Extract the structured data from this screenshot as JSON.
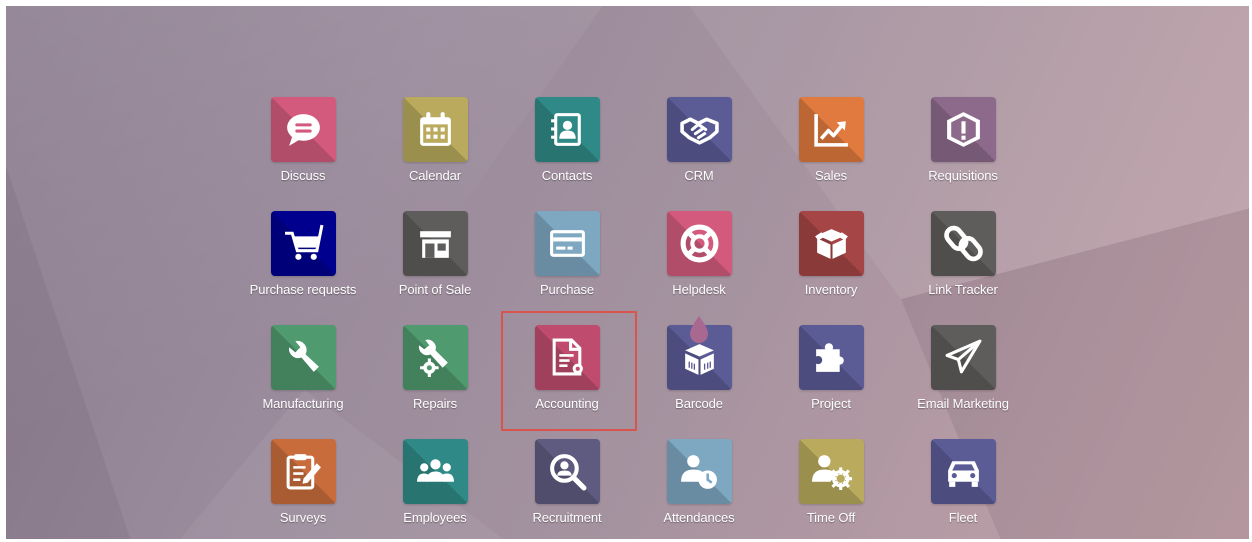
{
  "apps": [
    {
      "id": "discuss",
      "label": "Discuss",
      "icon": "chat-bubble-icon",
      "color": "#d35a7d"
    },
    {
      "id": "calendar",
      "label": "Calendar",
      "icon": "calendar-icon",
      "color": "#b9aa5d"
    },
    {
      "id": "contacts",
      "label": "Contacts",
      "icon": "address-book-icon",
      "color": "#2f8a87"
    },
    {
      "id": "crm",
      "label": "CRM",
      "icon": "handshake-icon",
      "color": "#5b5b96"
    },
    {
      "id": "sales",
      "label": "Sales",
      "icon": "trend-chart-icon",
      "color": "#e07a3e"
    },
    {
      "id": "requisitions",
      "label": "Requisitions",
      "icon": "alert-box-icon",
      "color": "#8d6a8b"
    },
    {
      "id": "purchase-requests",
      "label": "Purchase requests",
      "icon": "shopping-cart-icon",
      "color": "#00008f"
    },
    {
      "id": "point-of-sale",
      "label": "Point of Sale",
      "icon": "store-icon",
      "color": "#5f5d5b"
    },
    {
      "id": "purchase",
      "label": "Purchase",
      "icon": "credit-card-icon",
      "color": "#7ea7c2"
    },
    {
      "id": "helpdesk",
      "label": "Helpdesk",
      "icon": "life-ring-icon",
      "color": "#d35a7d"
    },
    {
      "id": "inventory",
      "label": "Inventory",
      "icon": "box-icon",
      "color": "#a64545"
    },
    {
      "id": "link-tracker",
      "label": "Link Tracker",
      "icon": "link-icon",
      "color": "#5f5d5b"
    },
    {
      "id": "manufacturing",
      "label": "Manufacturing",
      "icon": "wrench-icon",
      "color": "#4f9a6e"
    },
    {
      "id": "repairs",
      "label": "Repairs",
      "icon": "wrench-gear-icon",
      "color": "#4f9a6e"
    },
    {
      "id": "accounting",
      "label": "Accounting",
      "icon": "document-gear-icon",
      "color": "#bf4c6e"
    },
    {
      "id": "barcode",
      "label": "Barcode",
      "icon": "barcode-box-icon",
      "color": "#5b5b96"
    },
    {
      "id": "project",
      "label": "Project",
      "icon": "puzzle-icon",
      "color": "#5b5b96"
    },
    {
      "id": "email-marketing",
      "label": "Email Marketing",
      "icon": "paper-plane-icon",
      "color": "#5f5d5b"
    },
    {
      "id": "surveys",
      "label": "Surveys",
      "icon": "clipboard-pencil-icon",
      "color": "#c96c3b"
    },
    {
      "id": "employees",
      "label": "Employees",
      "icon": "people-icon",
      "color": "#2f8a87"
    },
    {
      "id": "recruitment",
      "label": "Recruitment",
      "icon": "magnifier-icon",
      "color": "#5f5a80"
    },
    {
      "id": "attendances",
      "label": "Attendances",
      "icon": "user-clock-icon",
      "color": "#7ea7c2"
    },
    {
      "id": "time-off",
      "label": "Time Off",
      "icon": "user-gear-icon",
      "color": "#b9aa5d"
    },
    {
      "id": "fleet",
      "label": "Fleet",
      "icon": "car-icon",
      "color": "#5b5b96"
    }
  ],
  "highlighted_app": "Accounting",
  "highlight_color": "#d9534f"
}
